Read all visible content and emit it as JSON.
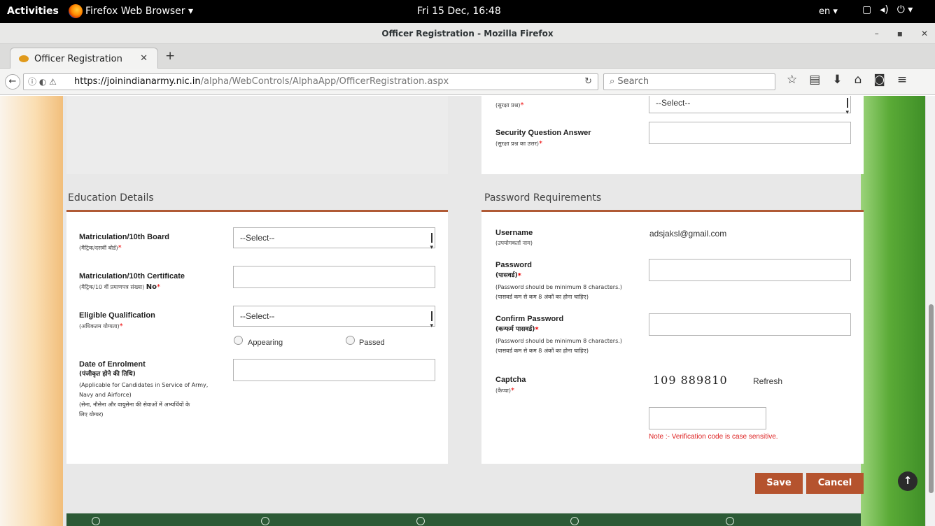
{
  "system_bar": {
    "activities": "Activities",
    "app_name": "Firefox Web Browser ▾",
    "clock": "Fri 15 Dec, 16:48",
    "language": "en ▾"
  },
  "window": {
    "title": "Officer Registration - Mozilla Firefox"
  },
  "browser": {
    "tab_title": "Officer Registration",
    "url_host": "https://joinindianarmy.nic.in",
    "url_path": "/alpha/WebControls/AlphaApp/OfficerRegistration.aspx",
    "search_placeholder": "Search"
  },
  "security": {
    "question_sub": "(सुरक्षा प्रश्न)",
    "question_select": "--Select--",
    "answer_label": "Security Question Answer",
    "answer_sub": "(सुरक्षा प्रश्न का उत्तर)"
  },
  "education": {
    "title": "Education Details",
    "matric_board_label": "Matriculation/10th Board",
    "matric_board_sub": "(मैट्रिक/दसवीं बोर्ड)",
    "matric_board_select": "--Select--",
    "matric_cert_label": "Matriculation/10th Certificate",
    "matric_cert_sub": "(मैट्रिक/10 वीं प्रमाणपत्र संख्या)",
    "matric_cert_no": "No",
    "qualification_label": "Eligible Qualification",
    "qualification_sub": "(अधिकतम योग्यता)",
    "qualification_select": "--Select--",
    "radio_appearing": "Appearing",
    "radio_passed": "Passed",
    "enrolment_label": "Date of Enrolment",
    "enrolment_sub_hi": "(पंजीकृत होने की तिथि)",
    "enrolment_note_1": "(Applicable for Candidates in Service of Army,",
    "enrolment_note_2": "Navy and Airforce)",
    "enrolment_note_3": "(सेना, नौसेना और वायुसेना की सेवाओं में अभ्यर्थियों के",
    "enrolment_note_4": "लिए योग्यर)"
  },
  "password": {
    "title": "Password Requirements",
    "username_label": "Username",
    "username_sub": "(उपयोगकर्ता नाम)",
    "username_value": "adsjaksl@gmail.com",
    "password_label": "Password",
    "password_sub": "(पासवर्ड)",
    "password_hint_en": "(Password should be minimum 8 characters.)",
    "password_hint_hi": "(पासवर्ड कम से कम 8 अंकों का होना चाहिए)",
    "confirm_label": "Confirm Password",
    "confirm_sub": "(कन्फर्म पासवर्ड)",
    "confirm_hint_en": "(Password should be minimum 8 characters.)",
    "confirm_hint_hi": "(पासवर्ड कम से कम 8 अंकों का होना चाहिए)",
    "captcha_label": "Captcha",
    "captcha_sub": "(कैप्चा)",
    "captcha_value": "109 889810",
    "refresh_label": "Refresh",
    "note": "Note :- Verification code is case sensitive."
  },
  "actions": {
    "save": "Save",
    "cancel": "Cancel"
  },
  "colors": {
    "accent": "#b5532e",
    "required": "#ee0000",
    "footer": "#2c5a36"
  }
}
